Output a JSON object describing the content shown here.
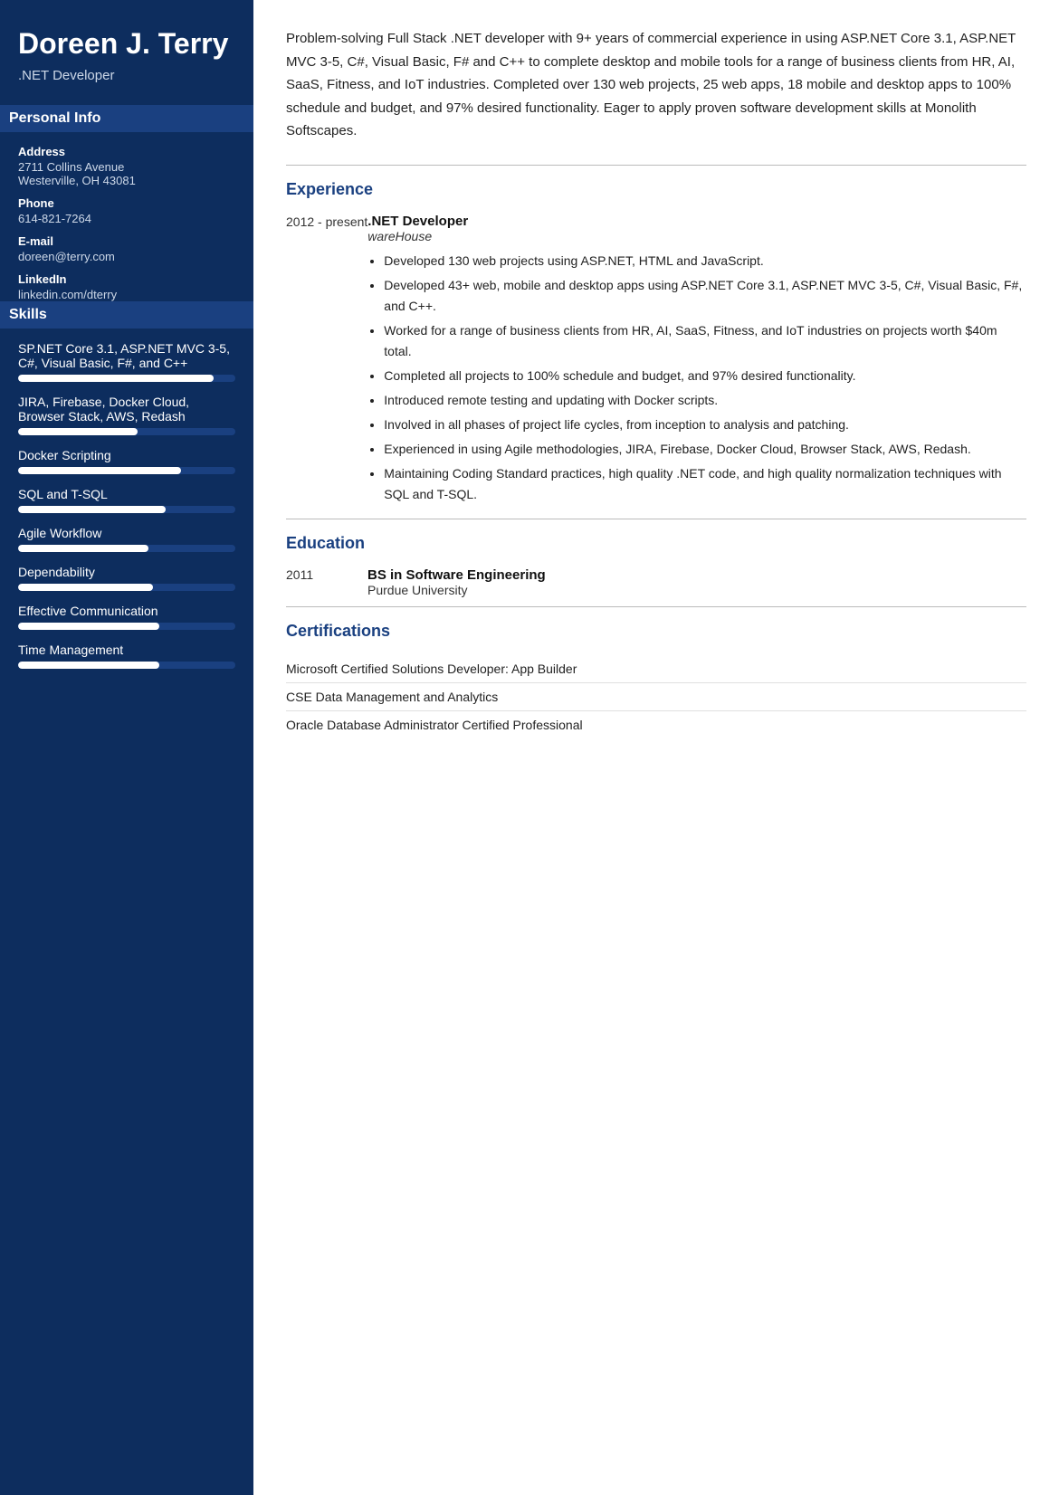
{
  "sidebar": {
    "name": "Doreen J. Terry",
    "title": ".NET Developer",
    "personal_info_header": "Personal Info",
    "address_label": "Address",
    "address_line1": "2711 Collins Avenue",
    "address_line2": "Westerville, OH 43081",
    "phone_label": "Phone",
    "phone_value": "614-821-7264",
    "email_label": "E-mail",
    "email_value": "doreen@terry.com",
    "linkedin_label": "LinkedIn",
    "linkedin_value": "linkedin.com/dterry",
    "skills_header": "Skills",
    "skills": [
      {
        "name": "SP.NET Core 3.1, ASP.NET MVC 3-5, C#, Visual Basic, F#, and C++",
        "fill_pct": 90,
        "dark_pct": 10
      },
      {
        "name": "JIRA, Firebase, Docker Cloud, Browser Stack, AWS, Redash",
        "fill_pct": 55,
        "dark_pct": 45
      },
      {
        "name": "Docker Scripting",
        "fill_pct": 75,
        "dark_pct": 25
      },
      {
        "name": "SQL and T-SQL",
        "fill_pct": 68,
        "dark_pct": 32
      },
      {
        "name": "Agile Workflow",
        "fill_pct": 60,
        "dark_pct": 40
      },
      {
        "name": "Dependability",
        "fill_pct": 62,
        "dark_pct": 38
      },
      {
        "name": "Effective Communication",
        "fill_pct": 65,
        "dark_pct": 35
      },
      {
        "name": "Time Management",
        "fill_pct": 65,
        "dark_pct": 35
      }
    ]
  },
  "main": {
    "summary": "Problem-solving Full Stack .NET developer with 9+ years of commercial experience in using ASP.NET Core 3.1, ASP.NET MVC 3-5, C#, Visual Basic, F# and C++ to complete desktop and mobile tools for a range of business clients from HR, AI, SaaS, Fitness, and IoT industries. Completed over 130 web projects, 25 web apps, 18 mobile and desktop apps to 100% schedule and budget, and 97% desired functionality. Eager to apply proven software development skills at Monolith Softscapes.",
    "experience_header": "Experience",
    "experience": [
      {
        "dates": "2012 - present",
        "job_title": ".NET Developer",
        "company": "wareHouse",
        "bullets": [
          "Developed 130 web projects using ASP.NET, HTML and JavaScript.",
          "Developed 43+ web, mobile and desktop apps using ASP.NET Core 3.1, ASP.NET MVC 3-5, C#, Visual Basic, F#, and C++.",
          "Worked for a range of business clients from HR, AI, SaaS, Fitness, and IoT industries on projects worth $40m total.",
          "Completed all projects to 100% schedule and budget, and 97% desired functionality.",
          "Introduced remote testing and updating with Docker scripts.",
          "Involved in all phases of project life cycles, from inception to analysis and patching.",
          "Experienced in using Agile methodologies, JIRA, Firebase, Docker Cloud, Browser Stack, AWS, Redash.",
          "Maintaining Coding Standard practices, high quality .NET code, and high quality normalization techniques with SQL and T-SQL."
        ]
      }
    ],
    "education_header": "Education",
    "education": [
      {
        "year": "2011",
        "degree": "BS in Software Engineering",
        "school": "Purdue University"
      }
    ],
    "certifications_header": "Certifications",
    "certifications": [
      "Microsoft Certified Solutions Developer: App Builder",
      "CSE Data Management and Analytics",
      "Oracle Database Administrator Certified Professional"
    ]
  }
}
